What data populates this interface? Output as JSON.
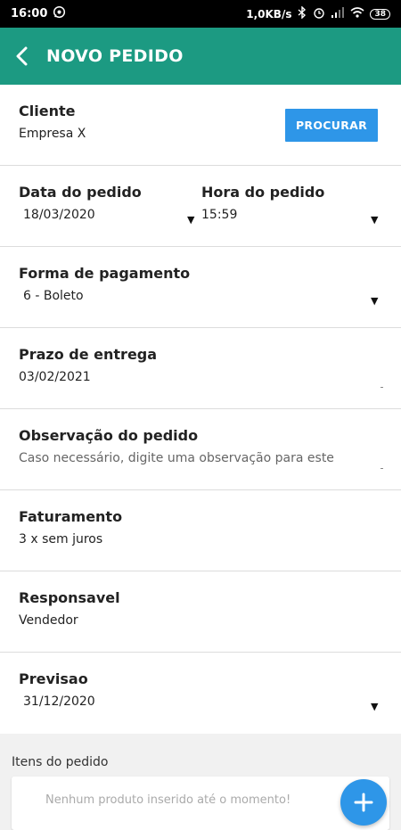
{
  "status_bar": {
    "time": "16:00",
    "net_speed": "1,0KB/s",
    "battery": "38"
  },
  "app_bar": {
    "title": "NOVO PEDIDO"
  },
  "form": {
    "cliente": {
      "label": "Cliente",
      "value": "Empresa X",
      "button": "PROCURAR"
    },
    "data_pedido": {
      "label": "Data do pedido",
      "value": "18/03/2020"
    },
    "hora_pedido": {
      "label": "Hora do pedido",
      "value": "15:59"
    },
    "forma_pagamento": {
      "label": "Forma de pagamento",
      "value": "6 - Boleto"
    },
    "prazo_entrega": {
      "label": "Prazo de entrega",
      "value": "03/02/2021"
    },
    "observacao": {
      "label": "Observação do pedido",
      "placeholder": "Caso necessário, digite uma observação para este"
    },
    "faturamento": {
      "label": "Faturamento",
      "value": "3 x sem juros"
    },
    "responsavel": {
      "label": "Responsavel",
      "value": "Vendedor"
    },
    "previsao": {
      "label": "Previsao",
      "value": "31/12/2020"
    }
  },
  "itens": {
    "label": "Itens do pedido",
    "empty_text": "Nenhum produto inserido até o momento!"
  },
  "colors": {
    "app_bar": "#1c9a82",
    "accent_button": "#2e96e8"
  }
}
